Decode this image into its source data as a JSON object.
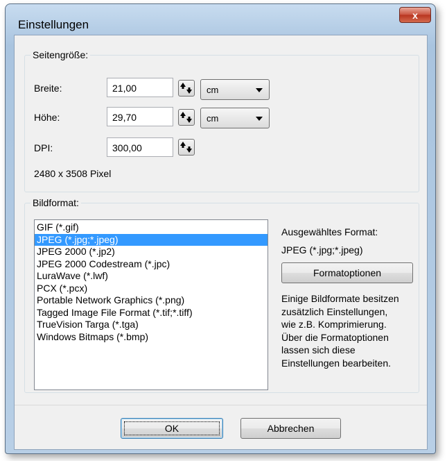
{
  "window": {
    "title": "Einstellungen",
    "close_glyph": "x"
  },
  "page_size": {
    "group_label": "Seitengröße:",
    "width_label": "Breite:",
    "width_value": "21,00",
    "width_unit": "cm",
    "height_label": "Höhe:",
    "height_value": "29,70",
    "height_unit": "cm",
    "dpi_label": "DPI:",
    "dpi_value": "300,00",
    "pixel_info": "2480 x 3508 Pixel"
  },
  "image_format": {
    "group_label": "Bildformat:",
    "formats": [
      "GIF (*.gif)",
      "JPEG (*.jpg;*.jpeg)",
      "JPEG 2000 (*.jp2)",
      "JPEG 2000 Codestream (*.jpc)",
      "LuraWave (*.lwf)",
      "PCX (*.pcx)",
      "Portable Network Graphics (*.png)",
      "Tagged Image File Format (*.tif;*.tiff)",
      "TrueVision Targa (*.tga)",
      "Windows Bitmaps (*.bmp)"
    ],
    "selected_index": 1,
    "selected_label": "Ausgewähltes Format:",
    "selected_value": "JPEG (*.jpg;*.jpeg)",
    "options_button": "Formatoptionen",
    "hint_lines": [
      "Einige Bildformate besitzen",
      "zusätzlich Einstellungen,",
      "wie z.B. Komprimierung.",
      "Über die Formatoptionen",
      "lassen sich diese",
      "Einstellungen bearbeiten."
    ]
  },
  "buttons": {
    "ok": "OK",
    "cancel": "Abbrechen"
  },
  "colors": {
    "selection": "#3399ff",
    "close_button": "#c9513d"
  }
}
